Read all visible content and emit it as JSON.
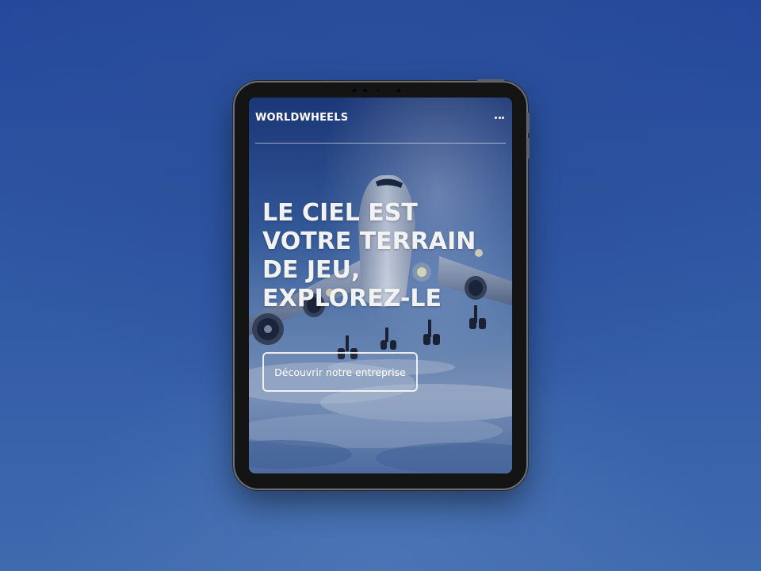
{
  "site": {
    "brand": "WORLDWHEELS",
    "menu_icon": "more-horizontal-icon"
  },
  "hero": {
    "title_lines": [
      "LE CIEL EST",
      "VOTRE TERRAIN",
      "DE JEU,",
      "EXPLOREZ-LE"
    ],
    "cta_label": "Découvrir notre entreprise",
    "background_image": "airplane-landing-image"
  },
  "colors": {
    "page_background": "#2f58a4",
    "device_frame": "#141414",
    "text": "#ffffff"
  }
}
